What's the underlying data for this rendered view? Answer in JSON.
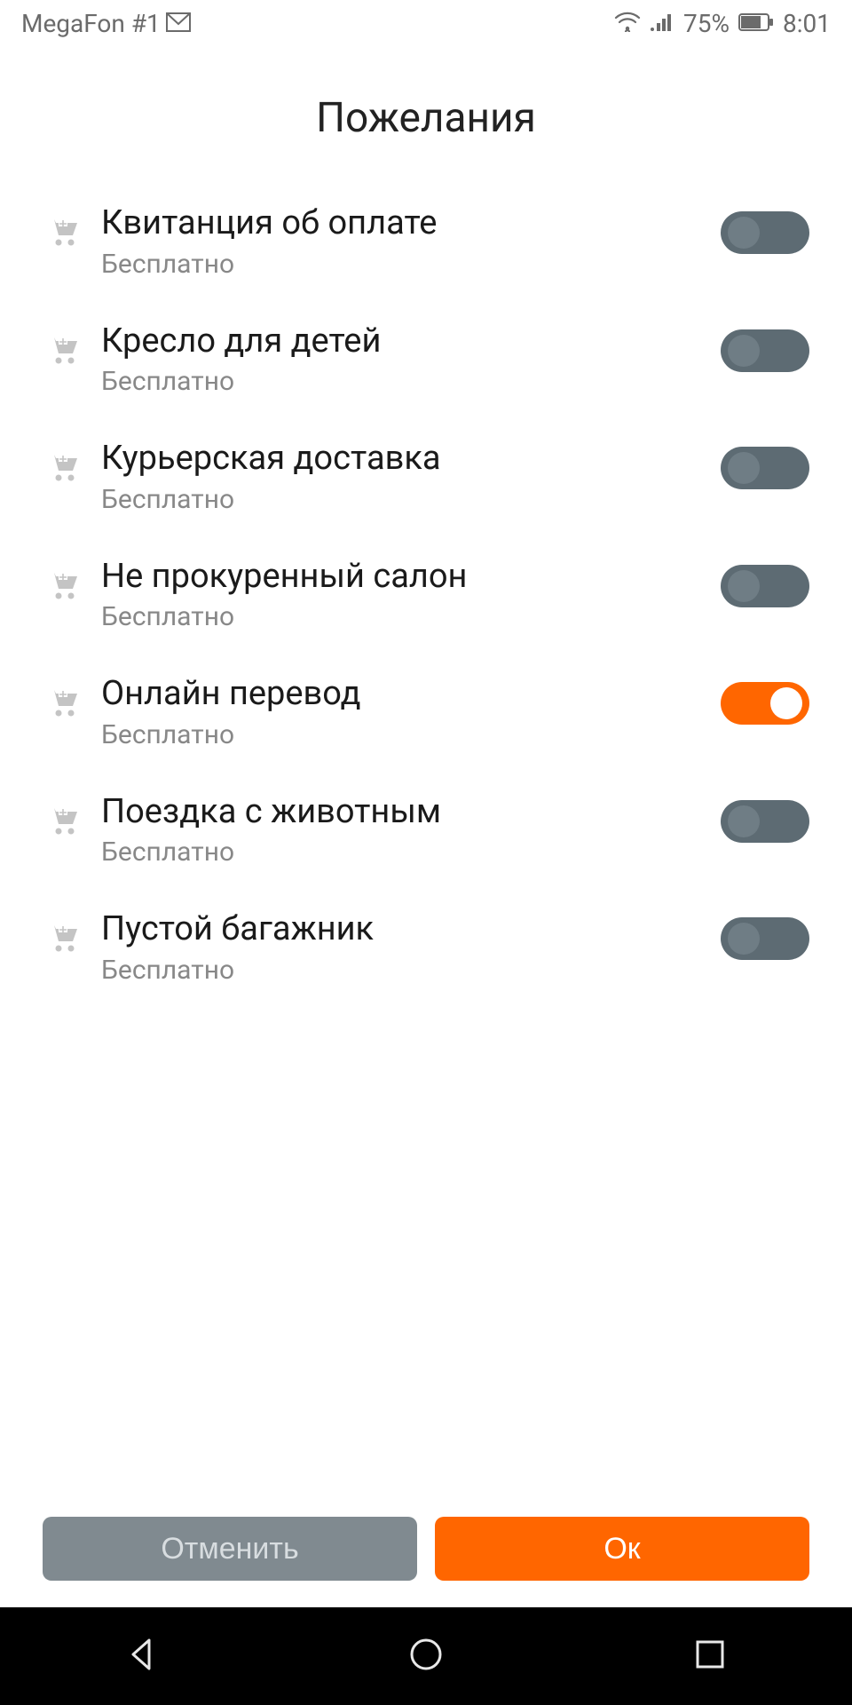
{
  "status": {
    "carrier": "MegaFon #1",
    "battery": "75%",
    "time": "8:01"
  },
  "title": "Пожелания",
  "free_label": "Бесплатно",
  "items": [
    {
      "label": "Квитанция об оплате",
      "on": false
    },
    {
      "label": "Кресло для детей",
      "on": false
    },
    {
      "label": "Курьерская доставка",
      "on": false
    },
    {
      "label": "Не прокуренный салон",
      "on": false
    },
    {
      "label": "Онлайн перевод",
      "on": true
    },
    {
      "label": "Поездка с животным",
      "on": false
    },
    {
      "label": "Пустой багажник",
      "on": false
    }
  ],
  "buttons": {
    "cancel": "Отменить",
    "ok": "Ок"
  }
}
